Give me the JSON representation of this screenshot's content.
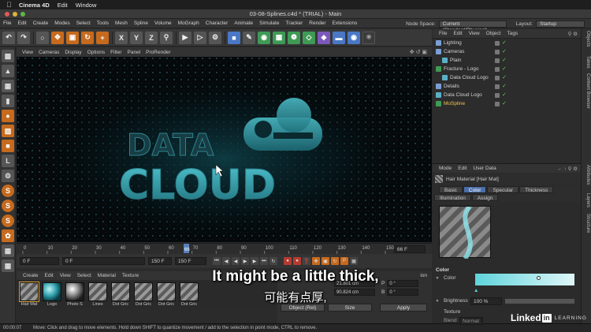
{
  "mac_menubar": {
    "app_name": "Cinema 4D",
    "menus": [
      "Edit",
      "Window"
    ]
  },
  "window": {
    "title": "03-08-Splines.c4d * (TRIAL) - Main"
  },
  "main_menu": {
    "items": [
      "File",
      "Edit",
      "Create",
      "Modes",
      "Select",
      "Tools",
      "Mesh",
      "Spline",
      "Volume",
      "MoGraph",
      "Character",
      "Animate",
      "Simulate",
      "Tracker",
      "Render",
      "Extensions"
    ],
    "node_space_label": "Node Space:",
    "node_space_value": "Current (Standard/Physical)",
    "layout_label": "Layout:",
    "layout_value": "Startup"
  },
  "toolbar": {
    "axis_x": "X",
    "axis_y": "Y",
    "axis_z": "Z"
  },
  "viewport": {
    "menu": [
      "View",
      "Cameras",
      "Display",
      "Options",
      "Filter",
      "Panel",
      "ProRender"
    ],
    "scene_text_line1": "DATA",
    "scene_text_line2": "CLOUD"
  },
  "timeline": {
    "ticks": [
      "0",
      "10",
      "20",
      "30",
      "40",
      "50",
      "60",
      "70",
      "80",
      "90",
      "100",
      "110",
      "120",
      "130",
      "140",
      "150"
    ],
    "current_frame_field": "66 F",
    "playhead_label": "66"
  },
  "frame_controls": {
    "start": "0 F",
    "current": "0 F",
    "end_preview": "150 F",
    "end": "150 F"
  },
  "material_manager": {
    "menu": [
      "Create",
      "Edit",
      "View",
      "Select",
      "Material",
      "Texture"
    ],
    "materials": [
      {
        "label": "Hair Mat",
        "swatch": "stripe"
      },
      {
        "label": "Logo",
        "swatch": "teal"
      },
      {
        "label": "Photo S",
        "swatch": "chrome"
      },
      {
        "label": "Lines",
        "swatch": "stripe"
      },
      {
        "label": "Dot Gric",
        "swatch": "stripe"
      },
      {
        "label": "Dot Gric",
        "swatch": "stripe"
      },
      {
        "label": "Dot Gric",
        "swatch": "stripe"
      },
      {
        "label": "Dot Gric",
        "swatch": "stripe"
      }
    ]
  },
  "coordinates": {
    "header": "ion",
    "rows": [
      {
        "a": "21.801 cm",
        "axis": "P",
        "b": "0 °"
      },
      {
        "a": "90.824 cm",
        "axis": "B",
        "b": "0 °"
      }
    ],
    "mode_select": "Object (Rel)",
    "size_select": "Size",
    "apply_label": "Apply"
  },
  "status_bar": {
    "time": "00:00:07",
    "message": "Move: Click and drag to move elements. Hold down SHIFT to quantize movement / add to the selection in point mode, CTRL to remove."
  },
  "object_manager": {
    "menu": [
      "File",
      "Edit",
      "View",
      "Object",
      "Tags"
    ],
    "objects": [
      {
        "name": "Lighting",
        "indent": 0,
        "selected": false
      },
      {
        "name": "Cameras",
        "indent": 0,
        "selected": false
      },
      {
        "name": "Plain",
        "indent": 1,
        "selected": false
      },
      {
        "name": "Fracture - Logo",
        "indent": 0,
        "selected": false
      },
      {
        "name": "Data Cloud Logo",
        "indent": 1,
        "selected": false
      },
      {
        "name": "Details",
        "indent": 0,
        "selected": false
      },
      {
        "name": "Data Cloud Logo",
        "indent": 0,
        "selected": false
      },
      {
        "name": "MoSpline",
        "indent": 0,
        "selected": true
      }
    ]
  },
  "side_tabs": [
    "Objects",
    "Takes",
    "Content Browser",
    "Attributes",
    "Layers",
    "Structure"
  ],
  "attribute_manager": {
    "menu": [
      "Mode",
      "Edit",
      "User Data"
    ],
    "title": "Hair Material [Hair Mat]",
    "tabs": [
      "Basic",
      "Color",
      "Specular",
      "Thickness",
      "Illumination",
      "Assign"
    ],
    "active_tab": "Color",
    "section_label": "Color",
    "color_label": "Color",
    "brightness_label": "Brightness",
    "brightness_value": "100 %",
    "texture_label": "Texture",
    "blend_label": "Blend",
    "blend_value": "Normal"
  },
  "subtitles": {
    "english": "It might be a little thick,",
    "chinese": "可能有点厚,"
  },
  "watermark": {
    "brand": "Linked",
    "in": "in",
    "suffix": "LEARNING"
  },
  "colors": {
    "accent_blue": "#4b6ea8",
    "teal_logo": "#3fb6c2",
    "orange_tool": "#c66a1e",
    "mospline_yellow": "#f0c54a"
  }
}
